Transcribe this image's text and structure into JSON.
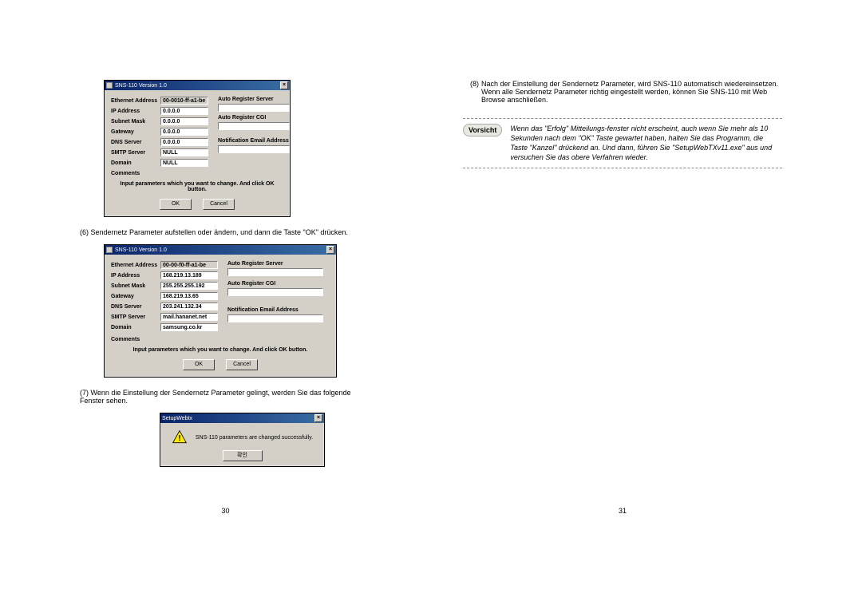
{
  "left": {
    "page_number": "30",
    "dlg1": {
      "title": "SNS-110 Version 1.0",
      "labels": [
        "Ethernet Address",
        "IP Address",
        "Subnet Mask",
        "Gateway",
        "DNS Server",
        "SMTP Server",
        "Domain",
        "Comments"
      ],
      "values": [
        "00-0010-ff-a1-be",
        "0.0.0.0",
        "0.0.0.0",
        "0.0.0.0",
        "0.0.0.0",
        "NULL",
        "NULL"
      ],
      "rlabels": [
        "Auto Register Server",
        "Auto Register CGI",
        "Notification Email Address"
      ],
      "hint": "Input parameters which you want to change. And click OK button.",
      "ok": "OK",
      "cancel": "Cancel"
    },
    "cap1_num": "(6)",
    "cap1_txt": "Sendernetz Parameter aufstellen oder ändern, und dann die Taste \"OK\" drücken.",
    "dlg2": {
      "title": "SNS-110  Version 1.0",
      "labels": [
        "Ethernet Address",
        "IP Address",
        "Subnet Mask",
        "Gateway",
        "DNS Server",
        "SMTP Server",
        "Domain",
        "Comments"
      ],
      "values": [
        "00-00-f0-ff-a1-be",
        "168.219.13.189",
        "255.255.255.192",
        "168.219.13.65",
        "203.241.132.34",
        "mail.hananet.net",
        "samsung.co.kr"
      ],
      "rlabels": [
        "Auto Register Server",
        "Auto Register CGI",
        "Notification Email Address"
      ],
      "hint": "Input parameters which you want to change. And click OK button.",
      "ok": "OK",
      "cancel": "Cancel"
    },
    "cap2_num": "(7)",
    "cap2_txt": "Wenn die Einstellung der Sendernetz Parameter gelingt, werden Sie das folgende Fenster sehen.",
    "msgbox": {
      "title": "SetupWebtx",
      "msg": "SNS-110 parameters are changed successfully.",
      "ok": "확인"
    }
  },
  "right": {
    "page_number": "31",
    "step_num": "(8)",
    "step_txt": "Nach der Einstellung der Sendernetz Parameter, wird SNS-110 automatisch wiedereinsetzen. Wenn alle Sendernetz Parameter richtig eingestellt werden, können Sie SNS-110 mit Web Browse anschließen.",
    "caution_label": "Vorsicht",
    "caution_txt": "Wenn das \"Erfolg\" Mitteilungs-fenster nicht erscheint, auch wenn Sie mehr als 10 Sekunden nach dem \"OK\" Taste gewartet haben, halten Sie das Programm, die Taste \"Kanzel\" drückend an. Und dann, führen Sie \"SetupWebTXv11.exe\" aus und versuchen Sie das obere Verfahren wieder."
  }
}
